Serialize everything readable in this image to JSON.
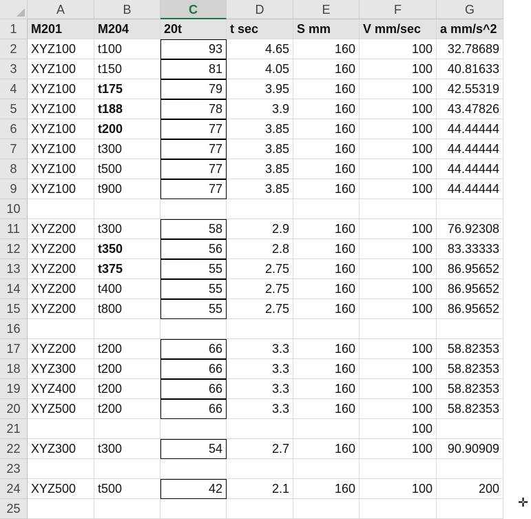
{
  "columns": [
    "A",
    "B",
    "C",
    "D",
    "E",
    "F",
    "G"
  ],
  "active_column": "C",
  "rows": [
    {
      "n": "1",
      "cells": [
        "M201",
        "M204",
        "20t",
        "t sec",
        "S mm",
        "V mm/sec",
        "a mm/s^2"
      ]
    },
    {
      "n": "2",
      "cells": [
        "XYZ100",
        "t100",
        "93",
        "4.65",
        "160",
        "100",
        "32.78689"
      ]
    },
    {
      "n": "3",
      "cells": [
        "XYZ100",
        "t150",
        "81",
        "4.05",
        "160",
        "100",
        "40.81633"
      ]
    },
    {
      "n": "4",
      "cells": [
        "XYZ100",
        "t175",
        "79",
        "3.95",
        "160",
        "100",
        "42.55319"
      ],
      "boldB": true
    },
    {
      "n": "5",
      "cells": [
        "XYZ100",
        "t188",
        "78",
        "3.9",
        "160",
        "100",
        "43.47826"
      ],
      "boldB": true
    },
    {
      "n": "6",
      "cells": [
        "XYZ100",
        "t200",
        "77",
        "3.85",
        "160",
        "100",
        "44.44444"
      ],
      "boldB": true
    },
    {
      "n": "7",
      "cells": [
        "XYZ100",
        "t300",
        "77",
        "3.85",
        "160",
        "100",
        "44.44444"
      ]
    },
    {
      "n": "8",
      "cells": [
        "XYZ100",
        "t500",
        "77",
        "3.85",
        "160",
        "100",
        "44.44444"
      ]
    },
    {
      "n": "9",
      "cells": [
        "XYZ100",
        "t900",
        "77",
        "3.85",
        "160",
        "100",
        "44.44444"
      ]
    },
    {
      "n": "10",
      "cells": [
        "",
        "",
        "",
        "",
        "",
        "",
        ""
      ]
    },
    {
      "n": "11",
      "cells": [
        "XYZ200",
        "t300",
        "58",
        "2.9",
        "160",
        "100",
        "76.92308"
      ]
    },
    {
      "n": "12",
      "cells": [
        "XYZ200",
        "t350",
        "56",
        "2.8",
        "160",
        "100",
        "83.33333"
      ],
      "boldB": true
    },
    {
      "n": "13",
      "cells": [
        "XYZ200",
        "t375",
        "55",
        "2.75",
        "160",
        "100",
        "86.95652"
      ],
      "boldB": true
    },
    {
      "n": "14",
      "cells": [
        "XYZ200",
        "t400",
        "55",
        "2.75",
        "160",
        "100",
        "86.95652"
      ]
    },
    {
      "n": "15",
      "cells": [
        "XYZ200",
        "t800",
        "55",
        "2.75",
        "160",
        "100",
        "86.95652"
      ]
    },
    {
      "n": "16",
      "cells": [
        "",
        "",
        "",
        "",
        "",
        "",
        ""
      ]
    },
    {
      "n": "17",
      "cells": [
        "XYZ200",
        "t200",
        "66",
        "3.3",
        "160",
        "100",
        "58.82353"
      ]
    },
    {
      "n": "18",
      "cells": [
        "XYZ300",
        "t200",
        "66",
        "3.3",
        "160",
        "100",
        "58.82353"
      ]
    },
    {
      "n": "19",
      "cells": [
        "XYZ400",
        "t200",
        "66",
        "3.3",
        "160",
        "100",
        "58.82353"
      ]
    },
    {
      "n": "20",
      "cells": [
        "XYZ500",
        "t200",
        "66",
        "3.3",
        "160",
        "100",
        "58.82353"
      ]
    },
    {
      "n": "21",
      "cells": [
        "",
        "",
        "",
        "",
        "",
        "100",
        ""
      ]
    },
    {
      "n": "22",
      "cells": [
        "XYZ300",
        "t300",
        "54",
        "2.7",
        "160",
        "100",
        "90.90909"
      ]
    },
    {
      "n": "23",
      "cells": [
        "",
        "",
        "",
        "",
        "",
        "",
        ""
      ]
    },
    {
      "n": "24",
      "cells": [
        "XYZ500",
        "t500",
        "42",
        "2.1",
        "160",
        "100",
        "200"
      ]
    },
    {
      "n": "25",
      "cells": [
        "",
        "",
        "",
        "",
        "",
        "",
        ""
      ]
    }
  ],
  "cursor_glyph": "✛"
}
